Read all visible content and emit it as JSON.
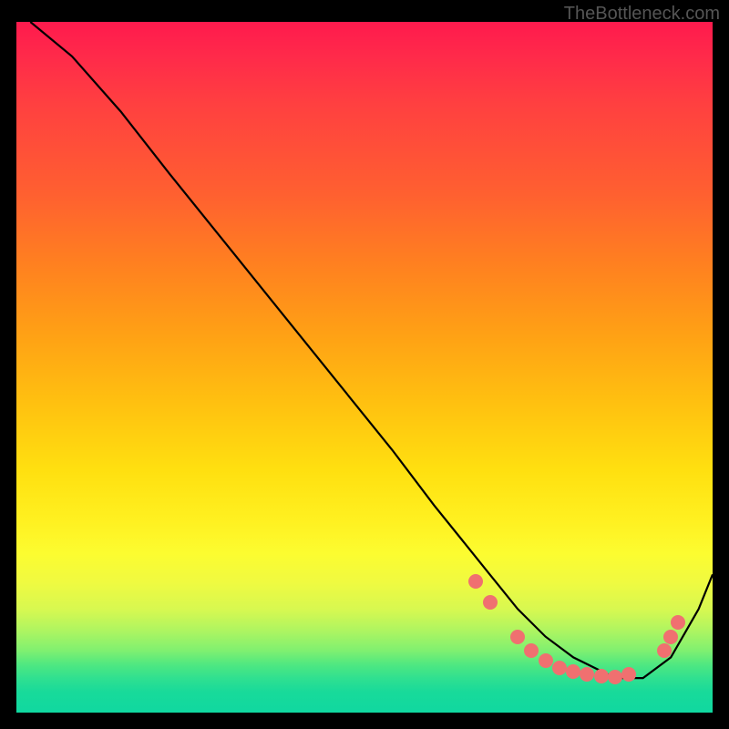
{
  "watermark": "TheBottleneck.com",
  "chart_data": {
    "type": "line",
    "title": "",
    "xlabel": "",
    "ylabel": "",
    "xlim": [
      0,
      100
    ],
    "ylim": [
      0,
      100
    ],
    "series": [
      {
        "name": "curve",
        "x": [
          2,
          8,
          15,
          22,
          30,
          38,
          46,
          54,
          60,
          64,
          68,
          72,
          76,
          80,
          84,
          86,
          90,
          94,
          98,
          100
        ],
        "y": [
          100,
          95,
          87,
          78,
          68,
          58,
          48,
          38,
          30,
          25,
          20,
          15,
          11,
          8,
          6,
          5,
          5,
          8,
          15,
          20
        ]
      }
    ],
    "markers": [
      {
        "x": 66,
        "y": 19
      },
      {
        "x": 68,
        "y": 16
      },
      {
        "x": 72,
        "y": 11
      },
      {
        "x": 74,
        "y": 9
      },
      {
        "x": 76,
        "y": 7.5
      },
      {
        "x": 78,
        "y": 6.5
      },
      {
        "x": 80,
        "y": 6
      },
      {
        "x": 82,
        "y": 5.5
      },
      {
        "x": 84,
        "y": 5.3
      },
      {
        "x": 86,
        "y": 5.2
      },
      {
        "x": 88,
        "y": 5.5
      },
      {
        "x": 93,
        "y": 9
      },
      {
        "x": 94,
        "y": 11
      },
      {
        "x": 95,
        "y": 13
      }
    ],
    "background_gradient": {
      "top": "#ff1a4d",
      "mid": "#ffe010",
      "bottom": "#10d8a0"
    }
  }
}
